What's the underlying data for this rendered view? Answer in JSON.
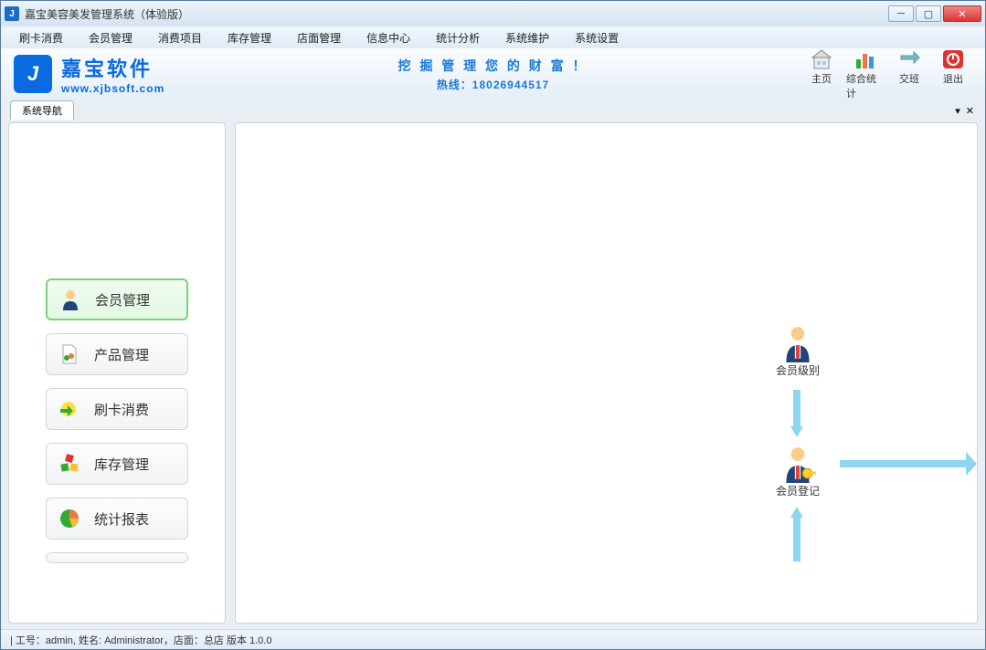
{
  "title": "嘉宝美容美发管理系统（体验版）",
  "menu": [
    "刷卡消费",
    "会员管理",
    "消费项目",
    "库存管理",
    "店面管理",
    "信息中心",
    "统计分析",
    "系统维护",
    "系统设置"
  ],
  "brand": {
    "name": "嘉宝软件",
    "url": "www.xjbsoft.com",
    "slogan": "挖 掘 管 理 您 的 财 富 ！",
    "hotline_label": "热线：",
    "hotline_number": "18026944517"
  },
  "toolbar": [
    {
      "id": "home",
      "label": "主页"
    },
    {
      "id": "stats",
      "label": "综合统计"
    },
    {
      "id": "shift",
      "label": "交班"
    },
    {
      "id": "exit",
      "label": "退出"
    }
  ],
  "tab_label": "系统导航",
  "nav": [
    {
      "id": "member",
      "label": "会员管理",
      "active": true
    },
    {
      "id": "product",
      "label": "产品管理"
    },
    {
      "id": "swipe",
      "label": "刷卡消费"
    },
    {
      "id": "stock",
      "label": "库存管理"
    },
    {
      "id": "report",
      "label": "统计报表"
    }
  ],
  "flow": {
    "node1": "会员级别",
    "node2": "会员登记"
  },
  "status": "| 工号：admin, 姓名: Administrator，店面：总店    版本 1.0.0"
}
